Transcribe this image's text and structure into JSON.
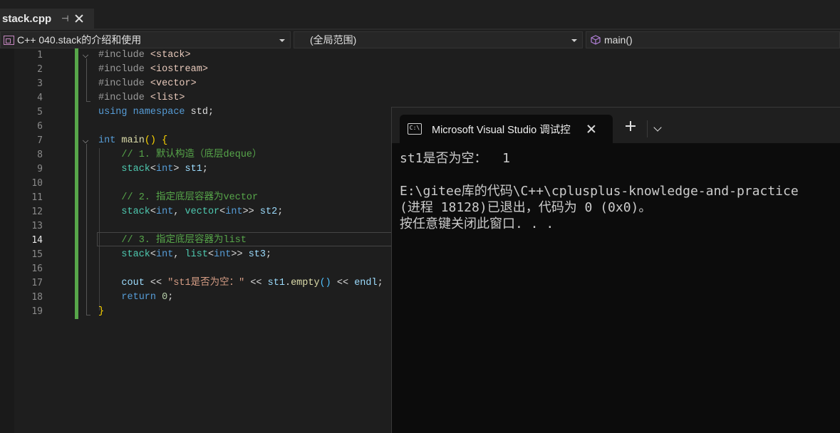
{
  "tab": {
    "title": "stack.cpp",
    "pin_icon": "pin-icon",
    "close_icon": "close-icon"
  },
  "nav": {
    "project": "C++ 040.stack的介绍和使用",
    "scope": "(全局范围)",
    "member": "main()"
  },
  "editor": {
    "line_numbers": [
      "1",
      "2",
      "3",
      "4",
      "5",
      "6",
      "7",
      "8",
      "9",
      "10",
      "11",
      "12",
      "13",
      "14",
      "15",
      "16",
      "17",
      "18",
      "19"
    ],
    "current_line": "14",
    "lines": [
      [
        [
          "pp",
          "#include "
        ],
        [
          "inc",
          "<stack>"
        ]
      ],
      [
        [
          "pp",
          "#include "
        ],
        [
          "inc",
          "<iostream>"
        ]
      ],
      [
        [
          "pp",
          "#include "
        ],
        [
          "inc",
          "<vector>"
        ]
      ],
      [
        [
          "pp",
          "#include "
        ],
        [
          "inc",
          "<list>"
        ]
      ],
      [
        [
          "kw",
          "using"
        ],
        [
          "punc",
          " "
        ],
        [
          "kw",
          "namespace"
        ],
        [
          "punc",
          " std;"
        ]
      ],
      [],
      [
        [
          "kw",
          "int"
        ],
        [
          "punc",
          " "
        ],
        [
          "fn",
          "main"
        ],
        [
          "gold",
          "()"
        ],
        [
          "punc",
          " "
        ],
        [
          "gold",
          "{"
        ]
      ],
      [
        [
          "com",
          "    // 1. 默认构造（底层deque）"
        ]
      ],
      [
        [
          "punc",
          "    "
        ],
        [
          "type",
          "stack"
        ],
        [
          "punc",
          "<"
        ],
        [
          "kw",
          "int"
        ],
        [
          "punc",
          "> "
        ],
        [
          "var",
          "st1"
        ],
        [
          "punc",
          ";"
        ]
      ],
      [],
      [
        [
          "com",
          "    // 2. 指定底层容器为vector"
        ]
      ],
      [
        [
          "punc",
          "    "
        ],
        [
          "type",
          "stack"
        ],
        [
          "punc",
          "<"
        ],
        [
          "kw",
          "int"
        ],
        [
          "punc",
          ", "
        ],
        [
          "type",
          "vector"
        ],
        [
          "punc",
          "<"
        ],
        [
          "kw",
          "int"
        ],
        [
          "punc",
          ">> "
        ],
        [
          "var",
          "st2"
        ],
        [
          "punc",
          ";"
        ]
      ],
      [],
      [
        [
          "com",
          "    // 3. 指定底层容器为list"
        ]
      ],
      [
        [
          "punc",
          "    "
        ],
        [
          "type",
          "stack"
        ],
        [
          "punc",
          "<"
        ],
        [
          "kw",
          "int"
        ],
        [
          "punc",
          ", "
        ],
        [
          "type",
          "list"
        ],
        [
          "punc",
          "<"
        ],
        [
          "kw",
          "int"
        ],
        [
          "punc",
          ">> "
        ],
        [
          "var",
          "st3"
        ],
        [
          "punc",
          ";"
        ]
      ],
      [],
      [
        [
          "punc",
          "    "
        ],
        [
          "var",
          "cout"
        ],
        [
          "punc",
          " << "
        ],
        [
          "str",
          "\"st1是否为空：\""
        ],
        [
          "punc",
          " << "
        ],
        [
          "var",
          "st1"
        ],
        [
          "punc",
          "."
        ],
        [
          "fn",
          "empty"
        ],
        [
          "cyan",
          "()"
        ],
        [
          "punc",
          " << "
        ],
        [
          "var",
          "endl"
        ],
        [
          "punc",
          ";"
        ]
      ],
      [
        [
          "punc",
          "    "
        ],
        [
          "kw",
          "return"
        ],
        [
          "punc",
          " "
        ],
        [
          "num",
          "0"
        ],
        [
          "punc",
          ";"
        ]
      ],
      [
        [
          "gold",
          "}"
        ]
      ]
    ]
  },
  "terminal": {
    "title": "Microsoft Visual Studio 调试控",
    "tab_icon": "cmd-icon",
    "icon_text": "C:\\",
    "output": [
      "st1是否为空：  1",
      "",
      "E:\\gitee库的代码\\C++\\cplusplus-knowledge-and-practice",
      "(进程 18128)已退出，代码为 0 (0x0)。",
      "按任意键关闭此窗口. . ."
    ]
  },
  "colors": {
    "background": "#1e1e1e",
    "change_bar": "#57a64a",
    "keyword": "#569cd6",
    "comment": "#57a64a",
    "type": "#4ec9b0",
    "string": "#d69d85",
    "terminal_bg": "#0c0c0c"
  }
}
